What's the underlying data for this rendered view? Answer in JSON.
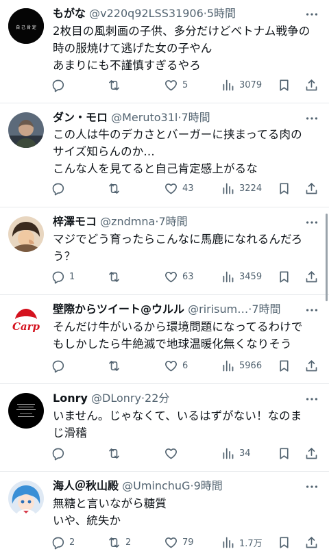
{
  "posts": [
    {
      "name": "もがな",
      "handle": "@v220q92LSS31906",
      "dot": "·",
      "time": "5時間",
      "text": "2枚目の風刺画の子供、多分だけどベトナム戦争の\n時の服焼けて逃げた女の子やん\nあまりにも不謹慎すぎるやろ",
      "replies": "",
      "retweets": "",
      "likes": "5",
      "views": "3079",
      "avatar_text": "自 己 肯 定"
    },
    {
      "name": "ダン・モロ",
      "handle": "@Meruto31l",
      "dot": "·",
      "time": "7時間",
      "text": "この人は牛のデカさとバーガーに挟まってる肉の\nサイズ知らんのか…\nこんな人を見てると自己肯定感上がるな",
      "replies": "",
      "retweets": "",
      "likes": "43",
      "views": "3224"
    },
    {
      "name": "梓澤モコ",
      "handle": "@zndmna",
      "dot": "·",
      "time": "7時間",
      "text": "マジでどう育ったらこんなに馬鹿になれるんだろ\nう？",
      "replies": "1",
      "retweets": "",
      "likes": "63",
      "views": "3459"
    },
    {
      "name": "壁際からツイート@ウルル",
      "handle": "@ririsum…",
      "dot": "·",
      "time": "7時間",
      "text": "そんだけ牛がいるから環境問題になってるわけで\nもしかしたら牛絶滅で地球温暖化無くなりそう",
      "replies": "",
      "retweets": "",
      "likes": "6",
      "views": "5966",
      "avatar_text": "Carp"
    },
    {
      "name": "Lonry",
      "handle": "@DLonry",
      "dot": "·",
      "time": "22分",
      "text": "いません。じゃなくて、いるはずがない！なのま\nじ滑稽",
      "replies": "",
      "retweets": "",
      "likes": "",
      "views": "34"
    },
    {
      "name": "海人＠秋山殿",
      "handle": "@UminchuG",
      "dot": "·",
      "time": "9時間",
      "text": "無糖と言いながら糖質\nいや、統失か",
      "replies": "2",
      "retweets": "2",
      "likes": "79",
      "views": "1.7万"
    }
  ],
  "icons": {
    "reply": "reply-icon",
    "retweet": "retweet-icon",
    "like": "heart-icon",
    "views": "views-icon",
    "bookmark": "bookmark-icon",
    "share": "share-icon",
    "more": "more-icon"
  },
  "colors": {
    "text": "#0f1419",
    "secondary": "#536471",
    "divider": "#e6e9ec"
  }
}
